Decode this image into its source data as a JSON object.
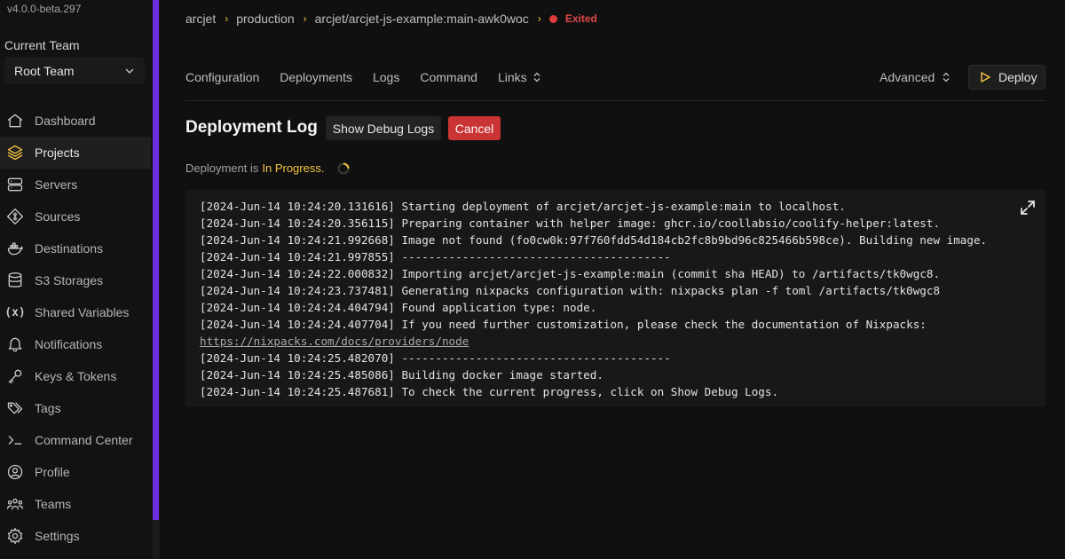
{
  "app": {
    "version": "v4.0.0-beta.297",
    "team_label": "Current Team",
    "team_selected": "Root Team"
  },
  "sidebar": {
    "items": [
      {
        "label": "Dashboard",
        "icon": "home-icon"
      },
      {
        "label": "Projects",
        "icon": "layers-icon",
        "active": true
      },
      {
        "label": "Servers",
        "icon": "server-icon"
      },
      {
        "label": "Sources",
        "icon": "git-icon"
      },
      {
        "label": "Destinations",
        "icon": "docker-icon"
      },
      {
        "label": "S3 Storages",
        "icon": "database-icon"
      },
      {
        "label": "Shared Variables",
        "icon": "variable-icon"
      },
      {
        "label": "Notifications",
        "icon": "bell-icon"
      },
      {
        "label": "Keys & Tokens",
        "icon": "key-icon"
      },
      {
        "label": "Tags",
        "icon": "tags-icon"
      },
      {
        "label": "Command Center",
        "icon": "terminal-icon"
      },
      {
        "label": "Profile",
        "icon": "user-icon"
      },
      {
        "label": "Teams",
        "icon": "users-icon"
      },
      {
        "label": "Settings",
        "icon": "gear-icon"
      }
    ]
  },
  "breadcrumb": {
    "items": [
      "arcjet",
      "production",
      "arcjet/arcjet-js-example:main-awk0woc"
    ],
    "status": "Exited",
    "status_color": "#dc3c3c"
  },
  "tabs": [
    "Configuration",
    "Deployments",
    "Logs",
    "Command",
    "Links"
  ],
  "advanced_label": "Advanced",
  "deploy_label": "Deploy",
  "page": {
    "title": "Deployment Log",
    "debug_button": "Show Debug Logs",
    "cancel_button": "Cancel",
    "progress_prefix": "Deployment is",
    "progress_status": "In Progress."
  },
  "logs": [
    "[2024-Jun-14 10:24:20.131616] Starting deployment of arcjet/arcjet-js-example:main to localhost.",
    "[2024-Jun-14 10:24:20.356115] Preparing container with helper image: ghcr.io/coollabsio/coolify-helper:latest.",
    "[2024-Jun-14 10:24:21.992668] Image not found (fo0cw0k:97f760fdd54d184cb2fc8b9bd96c825466b598ce). Building new image.",
    "[2024-Jun-14 10:24:21.997855] ----------------------------------------",
    "[2024-Jun-14 10:24:22.000832] Importing arcjet/arcjet-js-example:main (commit sha HEAD) to /artifacts/tk0wgc8.",
    "[2024-Jun-14 10:24:23.737481] Generating nixpacks configuration with: nixpacks plan -f toml /artifacts/tk0wgc8",
    "[2024-Jun-14 10:24:24.404794] Found application type: node.",
    "[2024-Jun-14 10:24:24.407704] If you need further customization, please check the documentation of Nixpacks:",
    "https://nixpacks.com/docs/providers/node",
    "[2024-Jun-14 10:24:25.482070] ----------------------------------------",
    "[2024-Jun-14 10:24:25.485086] Building docker image started.",
    "[2024-Jun-14 10:24:25.487681] To check the current progress, click on Show Debug Logs."
  ],
  "colors": {
    "accent": "#f5c542",
    "scrollbar": "#6b2fe0",
    "cancel": "#cb3434"
  }
}
